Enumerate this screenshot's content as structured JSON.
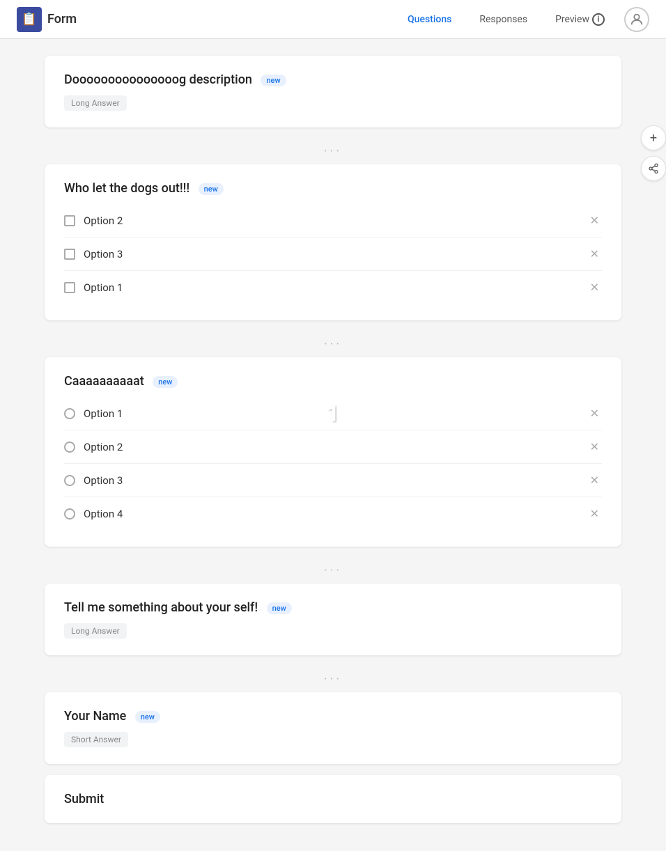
{
  "header": {
    "logo_emoji": "📋",
    "title": "Form",
    "nav": [
      {
        "id": "questions",
        "label": "Questions",
        "active": true
      },
      {
        "id": "responses",
        "label": "Responses",
        "active": false
      },
      {
        "id": "preview",
        "label": "Preview",
        "active": false
      }
    ]
  },
  "sections": [
    {
      "id": "section-description",
      "question": "Dooooooooooooooog description",
      "badge": "new",
      "type": "long_answer",
      "type_label": "Long Answer",
      "options": []
    },
    {
      "id": "section-dogs",
      "question": "Who let the dogs out!!!",
      "badge": "new",
      "type": "checkbox",
      "type_label": null,
      "options": [
        {
          "label": "Option 2"
        },
        {
          "label": "Option 3"
        },
        {
          "label": "Option 1"
        }
      ]
    },
    {
      "id": "section-cat",
      "question": "Caaaaaaaaaat",
      "badge": "new",
      "type": "radio",
      "type_label": null,
      "options": [
        {
          "label": "Option 1"
        },
        {
          "label": "Option 2"
        },
        {
          "label": "Option 3"
        },
        {
          "label": "Option 4"
        }
      ]
    },
    {
      "id": "section-about",
      "question": "Tell me something about your self!",
      "badge": "new",
      "type": "long_answer",
      "type_label": "Long Answer",
      "options": []
    },
    {
      "id": "section-name",
      "question": "Your Name",
      "badge": "new",
      "type": "short_answer",
      "type_label": "Short Answer",
      "options": []
    }
  ],
  "submit": {
    "label": "Submit"
  },
  "page_number": "1",
  "actions": {
    "add": "+",
    "share": "share"
  }
}
